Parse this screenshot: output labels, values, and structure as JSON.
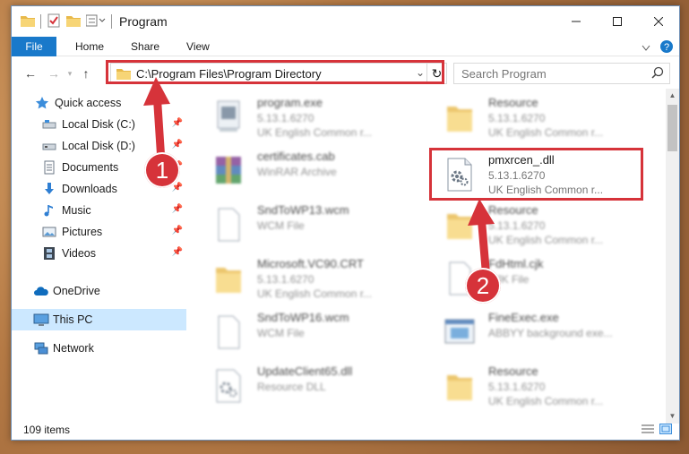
{
  "window": {
    "title": "Program"
  },
  "ribbon": {
    "tabs": [
      "File",
      "Home",
      "Share",
      "View"
    ]
  },
  "address": {
    "path": "C:\\Program Files\\Program Directory"
  },
  "search": {
    "placeholder": "Search Program"
  },
  "nav": {
    "quick_access": "Quick access",
    "items": [
      {
        "label": "Local Disk (C:)",
        "pinned": true
      },
      {
        "label": "Local Disk (D:)",
        "pinned": true
      },
      {
        "label": "Documents",
        "pinned": true
      },
      {
        "label": "Downloads",
        "pinned": true
      },
      {
        "label": "Music",
        "pinned": true
      },
      {
        "label": "Pictures",
        "pinned": true
      },
      {
        "label": "Videos",
        "pinned": true
      }
    ],
    "onedrive": "OneDrive",
    "this_pc": "This PC",
    "network": "Network"
  },
  "files": [
    {
      "name": "program.exe",
      "line2": "5.13.1.6270",
      "line3": "UK English Common r...",
      "icon": "exe-icon"
    },
    {
      "name": "Resource",
      "line2": "5.13.1.6270",
      "line3": "UK English Common r...",
      "icon": "folder-icon"
    },
    {
      "name": "certificates.cab",
      "line2": "WinRAR Archive",
      "line3": "",
      "icon": "winrar-icon"
    },
    {
      "name": "pmxrcen_.dll",
      "line2": "5.13.1.6270",
      "line3": "UK English Common r...",
      "icon": "dll-gear-icon"
    },
    {
      "name": "SndToWP13.wcm",
      "line2": "WCM File",
      "line3": "",
      "icon": "blank-file-icon"
    },
    {
      "name": "Resource",
      "line2": "5.13.1.6270",
      "line3": "UK English Common r...",
      "icon": "folder-icon"
    },
    {
      "name": "Microsoft.VC90.CRT",
      "line2": "5.13.1.6270",
      "line3": "UK English Common r...",
      "icon": "folder-icon"
    },
    {
      "name": "FdHtml.cjk",
      "line2": "CJK File",
      "line3": "",
      "icon": "blank-file-icon"
    },
    {
      "name": "SndToWP16.wcm",
      "line2": "WCM File",
      "line3": "",
      "icon": "blank-file-icon"
    },
    {
      "name": "FineExec.exe",
      "line2": "ABBYY background exe...",
      "line3": "",
      "icon": "app-window-icon"
    },
    {
      "name": "UpdateClient65.dll",
      "line2": "Resource DLL",
      "line3": "",
      "icon": "dll-gear-icon"
    },
    {
      "name": "Resource",
      "line2": "5.13.1.6270",
      "line3": "UK English Common r...",
      "icon": "folder-icon"
    }
  ],
  "status": {
    "count": "109 items"
  },
  "annotations": {
    "step1": "1",
    "step2": "2",
    "highlight_color": "#d6333a"
  },
  "colors": {
    "accent": "#1979ca",
    "selection": "#cce8ff"
  }
}
